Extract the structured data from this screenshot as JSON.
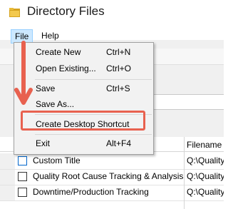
{
  "window": {
    "title": "Directory Files"
  },
  "menubar": {
    "file_label": "File",
    "help_label": "Help"
  },
  "file_menu": {
    "items": [
      {
        "label": "Create New",
        "shortcut": "Ctrl+N"
      },
      {
        "label": "Open Existing...",
        "shortcut": "Ctrl+O"
      },
      {
        "label": "Save",
        "shortcut": "Ctrl+S"
      },
      {
        "label": "Save As...",
        "shortcut": ""
      },
      {
        "label": "Create Desktop Shortcut",
        "shortcut": ""
      },
      {
        "label": "Exit",
        "shortcut": "Alt+F4"
      }
    ]
  },
  "table": {
    "columns": [
      "",
      "Filename"
    ],
    "rows": [
      {
        "title": "Custom Title",
        "file": "Q:\\Quality",
        "checked": false
      },
      {
        "title": "Quality Root Cause Tracking & Analysis",
        "file": "Q:\\Quality",
        "checked": false
      },
      {
        "title": "Downtime/Production Tracking",
        "file": "Q:\\Quality",
        "checked": false
      }
    ]
  },
  "colors": {
    "annotation": "#e8614f",
    "menu_hover": "#cce8ff",
    "app_icon": "#d4a21e"
  },
  "icons": {
    "app": "folder-icon",
    "annotation_arrow": "arrow-down-icon"
  }
}
